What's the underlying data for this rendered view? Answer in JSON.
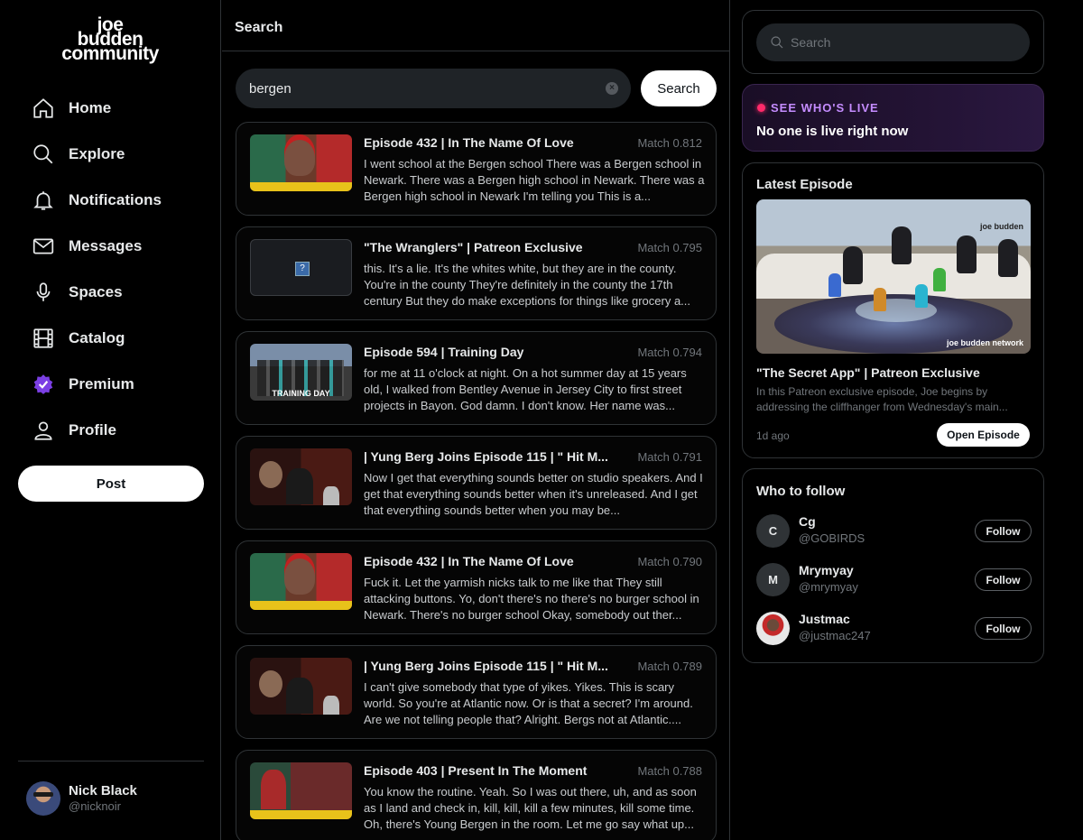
{
  "brand": {
    "logo_lines": [
      "joe",
      "budden",
      "community"
    ]
  },
  "nav": [
    {
      "label": "Home",
      "icon": "home-icon"
    },
    {
      "label": "Explore",
      "icon": "search-icon"
    },
    {
      "label": "Notifications",
      "icon": "bell-icon"
    },
    {
      "label": "Messages",
      "icon": "mail-icon"
    },
    {
      "label": "Spaces",
      "icon": "microphone-icon"
    },
    {
      "label": "Catalog",
      "icon": "film-icon"
    },
    {
      "label": "Premium",
      "icon": "premium-badge-icon"
    },
    {
      "label": "Profile",
      "icon": "user-icon"
    }
  ],
  "post_label": "Post",
  "current_user": {
    "name": "Nick Black",
    "handle": "@nicknoir"
  },
  "main": {
    "header": "Search",
    "query": "bergen",
    "clear_glyph": "×",
    "search_label": "Search",
    "results": [
      {
        "title": "Episode 432 | In The Name Of Love",
        "match": "Match 0.812",
        "thumb": "episode-432",
        "text": "I went school at the Bergen school There was a Bergen school in Newark. There was a Bergen high school in Newark. There was a Bergen high school in Newark I'm telling you This is a..."
      },
      {
        "title": "\"The Wranglers\" | Patreon Exclusive",
        "match": "Match 0.795",
        "thumb": "unknown",
        "text": "this. It's a lie. It's the whites white, but they are in the county. You're in the county They're definitely in the county the 17th century But they do make exceptions for things like grocery a..."
      },
      {
        "title": "Episode 594 | Training Day",
        "match": "Match 0.794",
        "thumb": "episode-594",
        "text": "for me at 11 o'clock at night. On a hot summer day at 15 years old, I walked from Bentley Avenue in Jersey City to first street projects in Bayon. God damn. I don't know. Her name was..."
      },
      {
        "title": "| Yung Berg Joins Episode 115 | \" Hit M...",
        "match": "Match 0.791",
        "thumb": "yung-berg",
        "text": "Now I get that everything sounds better on studio speakers. And I get that everything sounds better when it's unreleased. And I get that everything sounds better when you may be..."
      },
      {
        "title": "Episode 432 | In The Name Of Love",
        "match": "Match 0.790",
        "thumb": "episode-432",
        "text": "Fuck it. Let the yarmish nicks talk to me like that They still attacking buttons. Yo, don't there's no there's no burger school in Newark. There's no burger school Okay, somebody out ther..."
      },
      {
        "title": "| Yung Berg Joins Episode 115 | \" Hit M...",
        "match": "Match 0.789",
        "thumb": "yung-berg",
        "text": "I can't give somebody that type of yikes. Yikes. This is scary world. So you're at Atlantic now. Or is that a secret? I'm around. Are we not telling people that? Alright. Bergs not at Atlantic...."
      },
      {
        "title": "Episode 403 | Present In The Moment",
        "match": "Match 0.788",
        "thumb": "episode-403",
        "text": "You know the routine. Yeah. So I was out there, uh, and as soon as I land and check in, kill, kill, kill a few minutes, kill some time. Oh, there's Young Bergen in the room. Let me go say what up..."
      }
    ]
  },
  "right": {
    "search_placeholder": "Search",
    "live": {
      "label": "SEE WHO'S LIVE",
      "status": "No one is live right now"
    },
    "latest": {
      "heading": "Latest Episode",
      "brand_top": "joe budden",
      "brand_bottom": "joe budden network",
      "title": "\"The Secret App\" | Patreon Exclusive",
      "description": "In this Patreon exclusive episode, Joe begins by addressing the cliffhanger from Wednesday's main...",
      "age": "1d ago",
      "open_label": "Open Episode"
    },
    "follow": {
      "heading": "Who to follow",
      "follow_label": "Follow",
      "users": [
        {
          "initial": "C",
          "name": "Cg",
          "handle": "@GOBIRDS",
          "photo": false
        },
        {
          "initial": "M",
          "name": "Mrymyay",
          "handle": "@mrymyay",
          "photo": false
        },
        {
          "initial": "",
          "name": "Justmac",
          "handle": "@justmac247",
          "photo": true
        }
      ]
    }
  },
  "colors": {
    "background": "#000000",
    "border": "#2f3336",
    "live_accent": "#c58cff",
    "live_dot": "#ff2a6a",
    "muted": "#71767b"
  }
}
